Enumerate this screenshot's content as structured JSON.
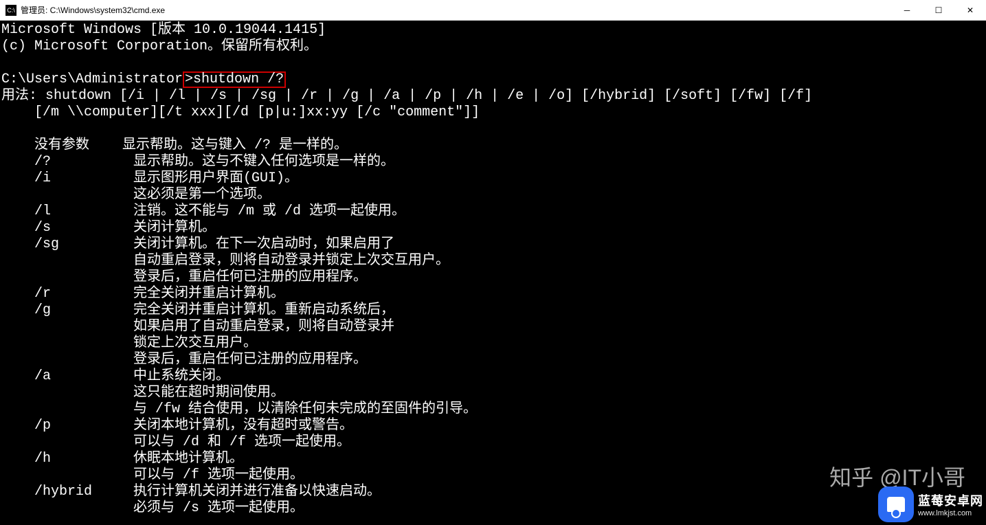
{
  "titlebar": {
    "icon_label": "C:\\",
    "title": "管理员: C:\\Windows\\system32\\cmd.exe"
  },
  "terminal": {
    "header": [
      "Microsoft Windows [版本 10.0.19044.1415]",
      "(c) Microsoft Corporation。保留所有权利。",
      ""
    ],
    "prompt_prefix": "C:\\Users\\Administrator>",
    "prompt_command": "shutdown /?",
    "usage": [
      "用法: shutdown [/i | /l | /s | /sg | /r | /g | /a | /p | /h | /e | /o] [/hybrid] [/soft] [/fw] [/f]",
      "    [/m \\\\computer][/t xxx][/d [p|u:]xx:yy [/c \"comment\"]]",
      ""
    ],
    "options": [
      {
        "flag": "没有参数",
        "desc": "显示帮助。这与键入 /? 是一样的。"
      },
      {
        "flag": "/?",
        "desc": "显示帮助。这与不键入任何选项是一样的。"
      },
      {
        "flag": "/i",
        "desc": "显示图形用户界面(GUI)。"
      },
      {
        "flag": "",
        "desc": "这必须是第一个选项。"
      },
      {
        "flag": "/l",
        "desc": "注销。这不能与 /m 或 /d 选项一起使用。"
      },
      {
        "flag": "/s",
        "desc": "关闭计算机。"
      },
      {
        "flag": "/sg",
        "desc": "关闭计算机。在下一次启动时，如果启用了"
      },
      {
        "flag": "",
        "desc": "自动重启登录，则将自动登录并锁定上次交互用户。"
      },
      {
        "flag": "",
        "desc": "登录后，重启任何已注册的应用程序。"
      },
      {
        "flag": "/r",
        "desc": "完全关闭并重启计算机。"
      },
      {
        "flag": "/g",
        "desc": "完全关闭并重启计算机。重新启动系统后，"
      },
      {
        "flag": "",
        "desc": "如果启用了自动重启登录，则将自动登录并"
      },
      {
        "flag": "",
        "desc": "锁定上次交互用户。"
      },
      {
        "flag": "",
        "desc": "登录后，重启任何已注册的应用程序。"
      },
      {
        "flag": "/a",
        "desc": "中止系统关闭。"
      },
      {
        "flag": "",
        "desc": "这只能在超时期间使用。"
      },
      {
        "flag": "",
        "desc": "与 /fw 结合使用，以清除任何未完成的至固件的引导。"
      },
      {
        "flag": "/p",
        "desc": "关闭本地计算机，没有超时或警告。"
      },
      {
        "flag": "",
        "desc": "可以与 /d 和 /f 选项一起使用。"
      },
      {
        "flag": "/h",
        "desc": "休眠本地计算机。"
      },
      {
        "flag": "",
        "desc": "可以与 /f 选项一起使用。"
      },
      {
        "flag": "/hybrid",
        "desc": "执行计算机关闭并进行准备以快速启动。"
      },
      {
        "flag": "",
        "desc": "必须与 /s 选项一起使用。"
      }
    ]
  },
  "watermark": {
    "zhihu": "知乎 @IT小哥",
    "brand_cn": "蓝莓安卓网",
    "brand_en": "www.lmkjst.com"
  }
}
